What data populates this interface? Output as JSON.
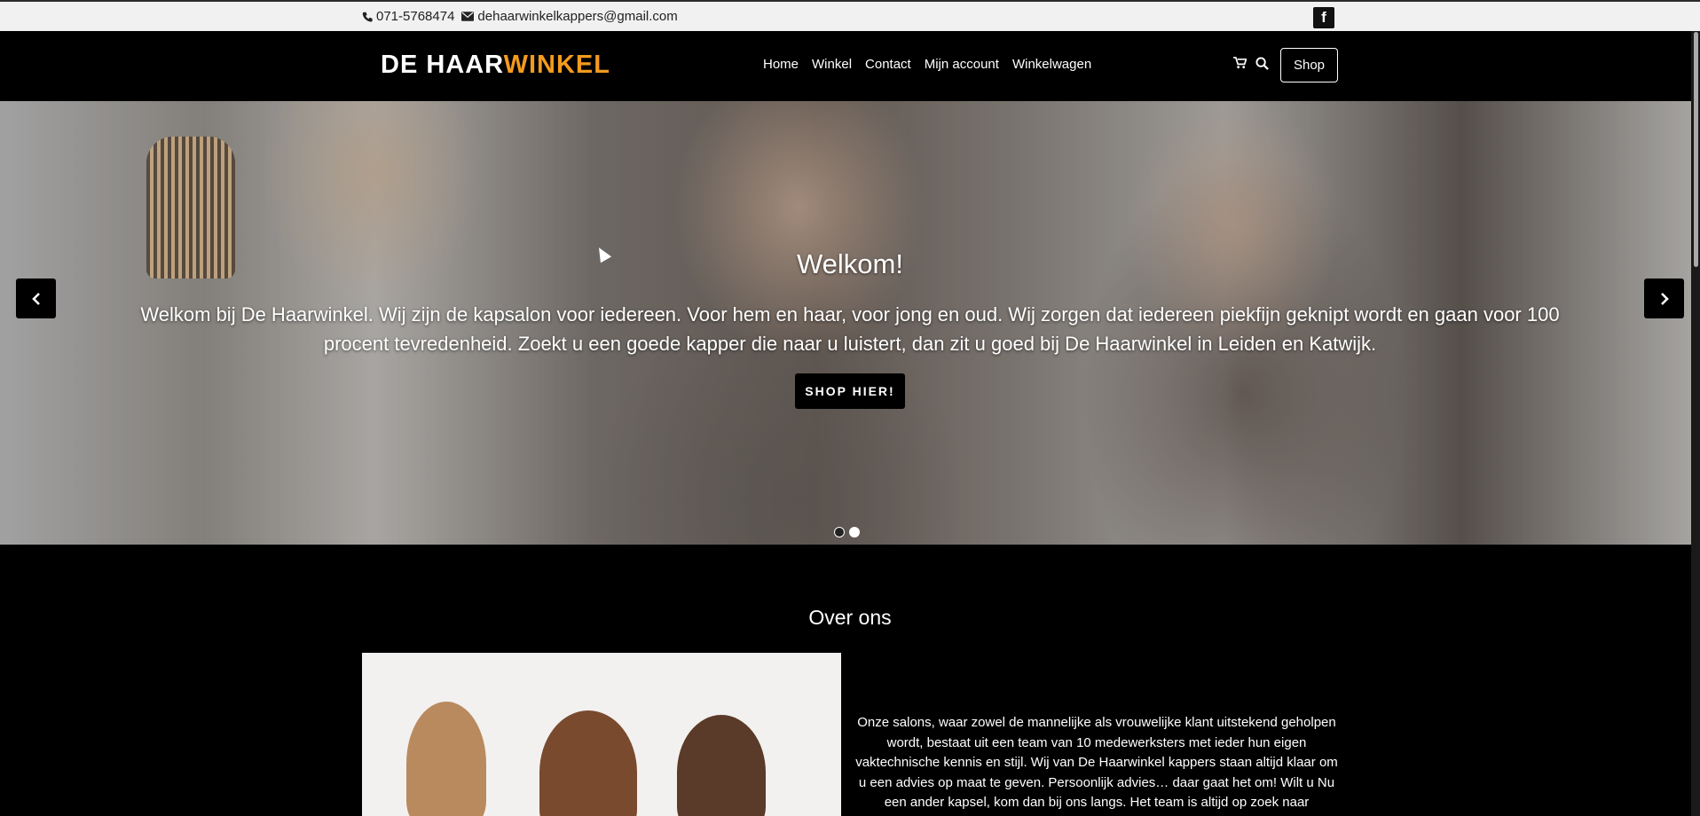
{
  "topbar": {
    "phone": "071-5768474",
    "email": "dehaarwinkelkappers@gmail.com",
    "facebook_glyph": "f"
  },
  "header": {
    "logo_part1": "DE HAAR",
    "logo_part2": "WINKEL",
    "nav": [
      "Home",
      "Winkel",
      "Contact",
      "Mijn account",
      "Winkelwagen"
    ],
    "shop_label": "Shop",
    "accent_color": "#f39a1f"
  },
  "hero": {
    "title": "Welkom!",
    "text": "Welkom bij De Haarwinkel. Wij zijn de kapsalon voor iedereen. Voor hem en haar, voor jong en oud. Wij zorgen dat iedereen piekfijn geknipt wordt en gaan voor 100 procent tevredenheid. Zoekt u een goede kapper die naar u luistert, dan zit u goed bij De Haarwinkel in Leiden en Katwijk.",
    "cta": "SHOP HIER!",
    "slide_count": 2,
    "active_slide": 1
  },
  "about": {
    "title": "Over ons",
    "text": "Onze salons, waar zowel de mannelijke als vrouwelijke klant uitstekend geholpen wordt, bestaat uit een team van 10 medewerksters met ieder hun eigen vaktechnische kennis en stijl. Wij van De Haarwinkel kappers staan altijd klaar om u een advies op maat te geven. Persoonlijk advies… daar gaat het om! Wilt u Nu een ander kapsel, kom dan bij ons langs. Het team is altijd op zoek naar"
  },
  "icons": {
    "phone": "phone-icon",
    "email": "envelope-icon",
    "facebook": "facebook-icon",
    "cart": "cart-icon",
    "search": "search-icon",
    "prev": "chevron-left-icon",
    "next": "chevron-right-icon"
  }
}
